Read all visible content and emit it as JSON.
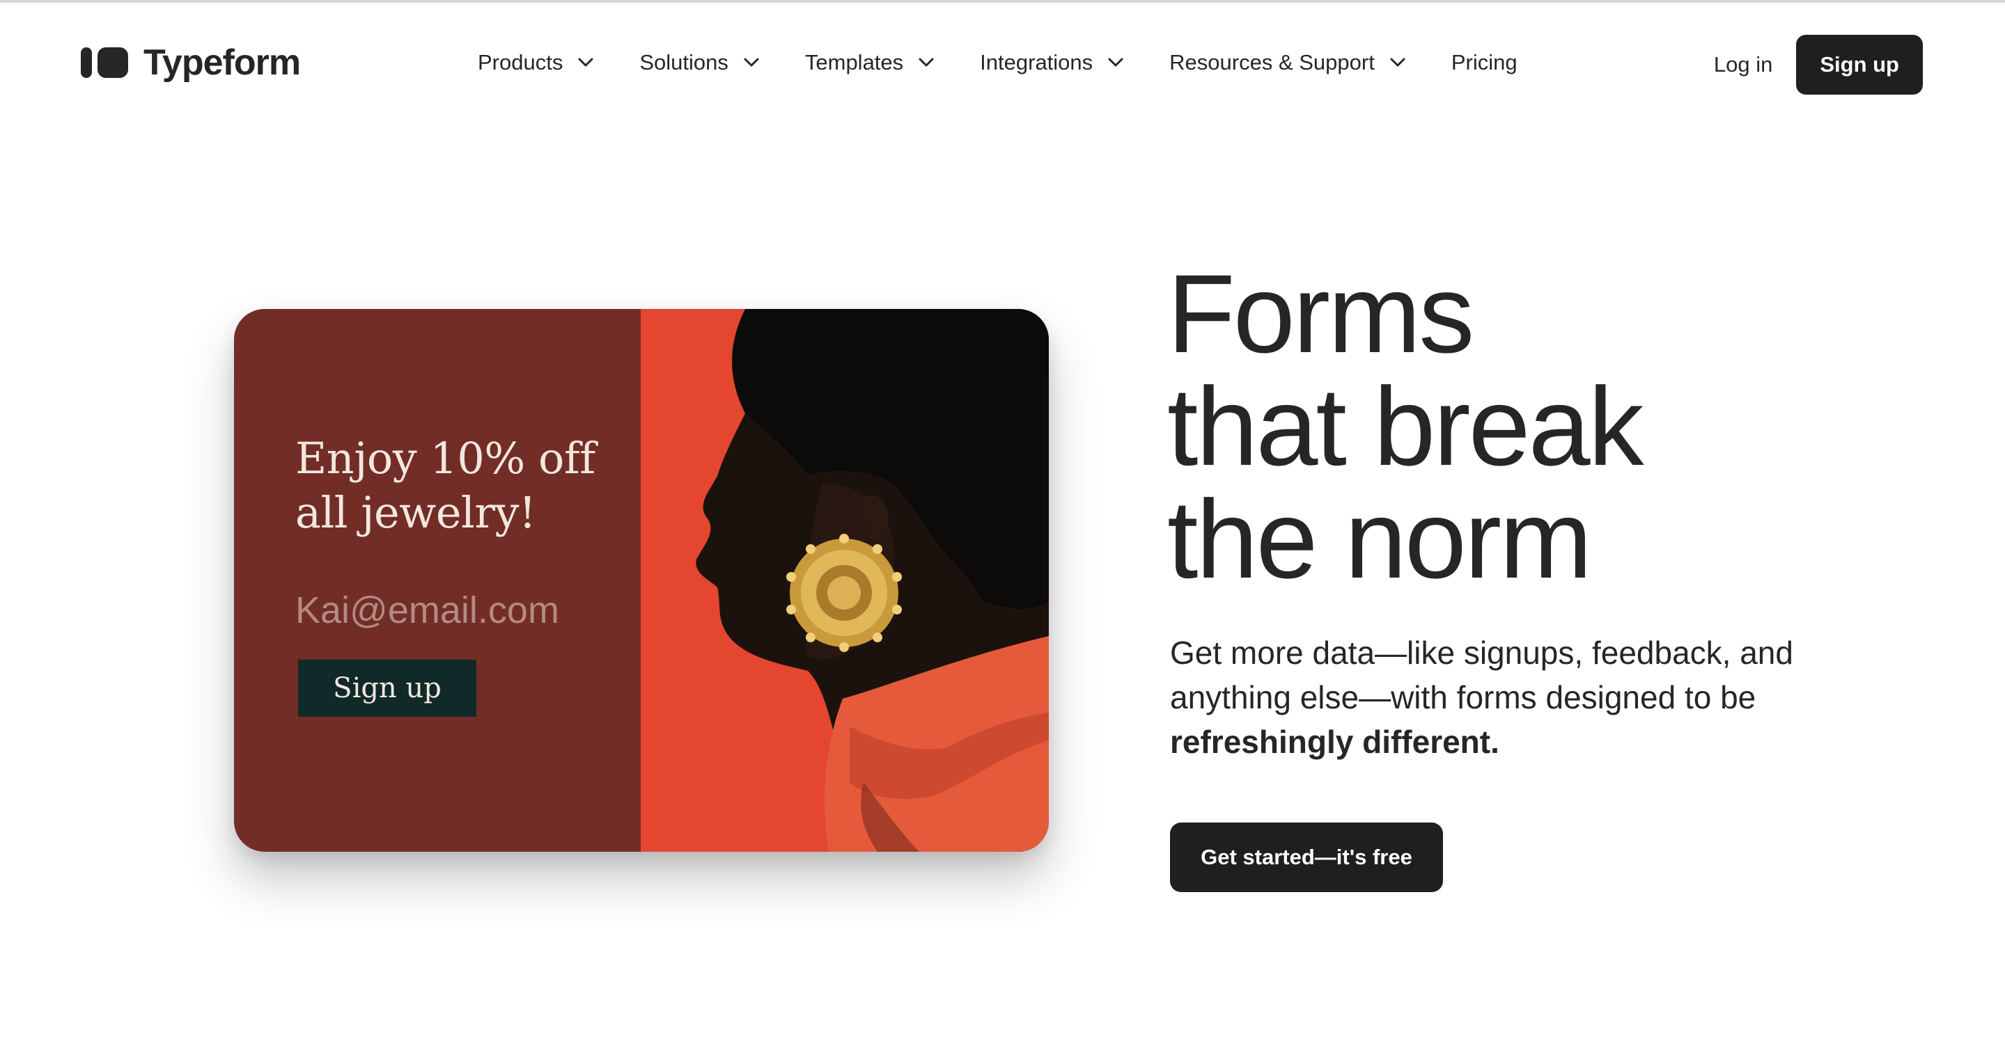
{
  "brand": {
    "name": "Typeform",
    "logo_icon": "typeform-logo-icon",
    "ink_color": "#262627"
  },
  "nav": {
    "items": [
      {
        "label": "Products",
        "has_dropdown": true
      },
      {
        "label": "Solutions",
        "has_dropdown": true
      },
      {
        "label": "Templates",
        "has_dropdown": true
      },
      {
        "label": "Integrations",
        "has_dropdown": true
      },
      {
        "label": "Resources & Support",
        "has_dropdown": true
      },
      {
        "label": "Pricing",
        "has_dropdown": false
      }
    ],
    "dropdown_icon": "chevron-down-icon",
    "login_label": "Log in",
    "signup_label": "Sign up",
    "button_color": "#1f1f1f"
  },
  "hero_card": {
    "promo_title": "Enjoy 10% off all jewelry!",
    "email_placeholder": "Kai@email.com",
    "signup_label": "Sign up",
    "left_panel_color": "#722d26",
    "right_panel_color": "#e4462f",
    "button_color": "#0f2a28",
    "photo": "profile-portrait-with-gold-earring"
  },
  "hero": {
    "title_line1": "Forms",
    "title_line2": "that break",
    "title_line3": "the norm",
    "subtitle_line1": "Get more data—like signups, feedback, and",
    "subtitle_line2": "anything else—with forms designed to be",
    "subtitle_bold": "refreshingly different.",
    "cta_label": "Get started—it's free"
  }
}
